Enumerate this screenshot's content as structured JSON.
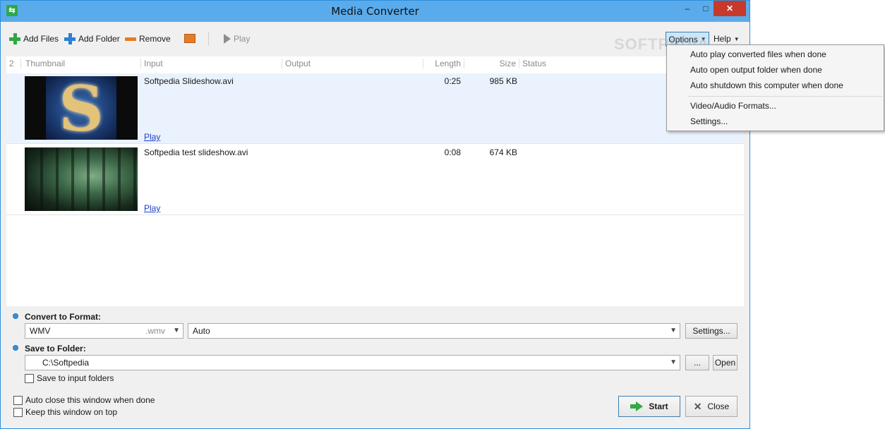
{
  "window": {
    "title": "Media Converter"
  },
  "toolbar": {
    "add_files": "Add Files",
    "add_folder": "Add Folder",
    "remove": "Remove",
    "play": "Play",
    "options": "Options",
    "help": "Help"
  },
  "watermark": "SOFTPEDIA",
  "list": {
    "count": "2",
    "columns": {
      "thumbnail": "Thumbnail",
      "input": "Input",
      "output": "Output",
      "length": "Length",
      "size": "Size",
      "status": "Status"
    },
    "rows": [
      {
        "input": "Softpedia Slideshow.avi",
        "length": "0:25",
        "size": "985 KB",
        "play": "Play",
        "selected": true
      },
      {
        "input": "Softpedia test slideshow.avi",
        "length": "0:08",
        "size": "674 KB",
        "play": "Play",
        "selected": false
      }
    ]
  },
  "format": {
    "label": "Convert to Format:",
    "value": "WMV",
    "ext": ".wmv",
    "quality": "Auto",
    "settings": "Settings..."
  },
  "folder": {
    "label": "Save to Folder:",
    "path": "C:\\Softpedia",
    "browse": "...",
    "open": "Open",
    "save_to_input": "Save to input folders"
  },
  "footer": {
    "auto_close": "Auto close this window when done",
    "keep_on_top": "Keep this window on top",
    "start": "Start",
    "close": "Close"
  },
  "options_menu": {
    "items": [
      "Auto play converted files when done",
      "Auto open output folder when done",
      "Auto shutdown this computer when done",
      "Video/Audio Formats...",
      "Settings..."
    ]
  },
  "colors": {
    "titlebar": "#5aabec",
    "accent": "#3c7fb1",
    "close_button": "#c7392b",
    "add_green": "#2fa845",
    "add_blue": "#2d7fd2",
    "remove_orange": "#e97a20"
  }
}
